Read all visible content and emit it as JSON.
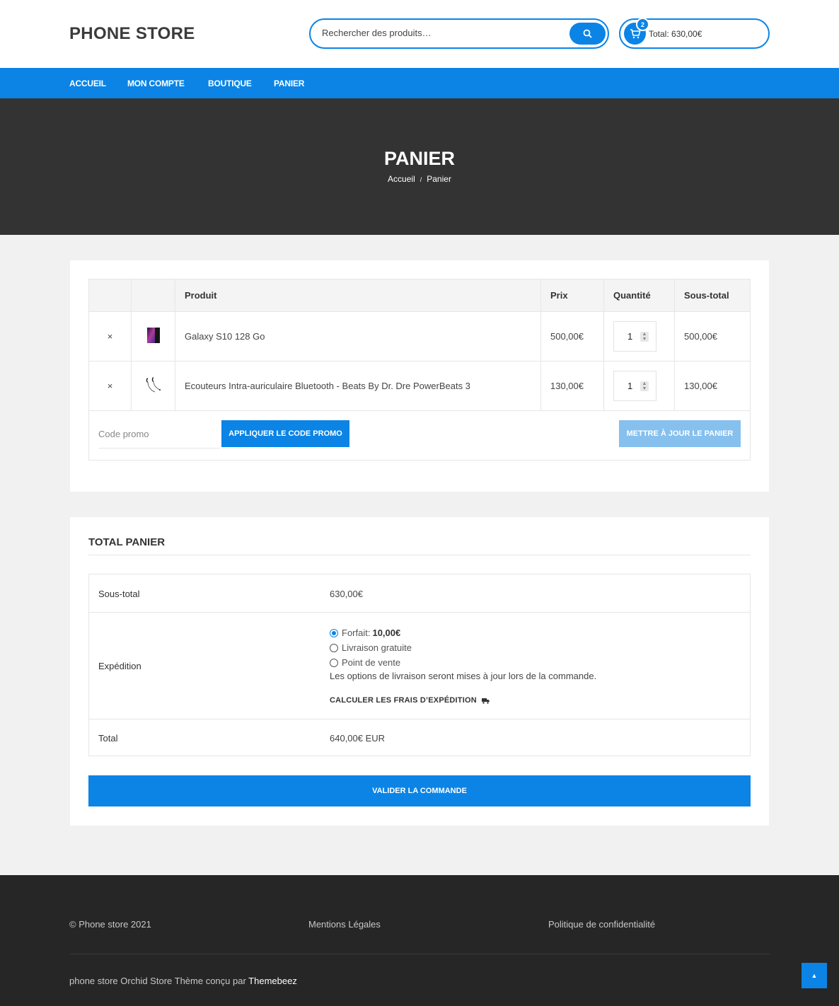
{
  "header": {
    "logo": "PHONE STORE",
    "search_placeholder": "Rechercher des produits…",
    "cart_count": "2",
    "cart_total": "Total: 630,00€"
  },
  "nav": {
    "items": [
      "ACCUEIL",
      "MON COMPTE",
      "BOUTIQUE",
      "PANIER"
    ]
  },
  "hero": {
    "title": "PANIER",
    "breadcrumb_home": "Accueil",
    "breadcrumb_sep": "/",
    "breadcrumb_current": "Panier"
  },
  "cart": {
    "headers": {
      "product": "Produit",
      "price": "Prix",
      "quantity": "Quantité",
      "subtotal": "Sous-total"
    },
    "remove_symbol": "×",
    "items": [
      {
        "name": "Galaxy S10 128 Go",
        "price": "500,00€",
        "qty": "1",
        "subtotal": "500,00€"
      },
      {
        "name": "Ecouteurs Intra-auriculaire Bluetooth - Beats By Dr. Dre PowerBeats 3",
        "price": "130,00€",
        "qty": "1",
        "subtotal": "130,00€"
      }
    ],
    "promo_placeholder": "Code promo",
    "apply_label": "APPLIQUER LE CODE PROMO",
    "update_label": "METTRE À JOUR LE PANIER"
  },
  "totals": {
    "title": "TOTAL PANIER",
    "subtotal_label": "Sous-total",
    "subtotal_value": "630,00€",
    "shipping_label": "Expédition",
    "shipping_options": [
      {
        "label": "Forfait: ",
        "amount": "10,00€",
        "checked": true
      },
      {
        "label": "Livraison gratuite",
        "amount": "",
        "checked": false
      },
      {
        "label": "Point de vente",
        "amount": "",
        "checked": false
      }
    ],
    "shipping_note": "Les options de livraison seront mises à jour lors de la commande.",
    "calc_label": "CALCULER LES FRAIS D’EXPÉDITION",
    "total_label": "Total",
    "total_value": "640,00€ EUR",
    "validate_label": "VALIDER LA COMMANDE"
  },
  "footer": {
    "copyright": "© Phone store 2021",
    "legal": "Mentions Légales",
    "privacy": "Politique de confidentialité",
    "credit_prefix": "phone store Orchid Store Thème conçu par ",
    "credit_brand": "Themebeez"
  },
  "colors": {
    "accent": "#0b84e6",
    "hero_bg": "#333333",
    "footer_bg": "#262626"
  }
}
